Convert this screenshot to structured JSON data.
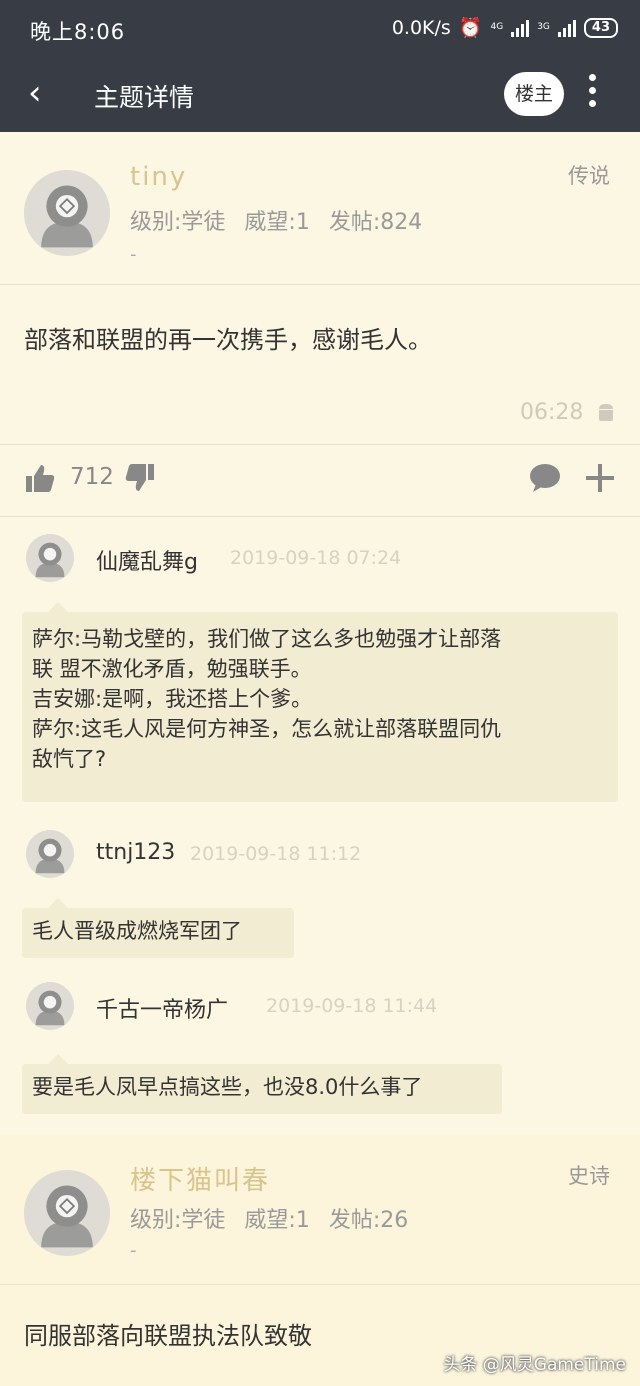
{
  "status_bar": {
    "time": "晚上8:06",
    "speed": "0.0K/s",
    "net1": "4G",
    "net2": "3G",
    "battery": "43"
  },
  "header": {
    "back_icon": "chevron-left-icon",
    "title": "主题详情",
    "op_button": "楼主",
    "more_icon": "more-vertical-icon"
  },
  "post1": {
    "username": "tiny",
    "rank": "传说",
    "level": "级别:学徒",
    "prestige": "威望:1",
    "posts": "发帖:824",
    "signature": "-",
    "content": "部落和联盟的再一次携手，感谢毛人。",
    "time": "06:28",
    "like_count": "712",
    "comments": [
      {
        "name": "仙魔乱舞g",
        "time": "2019-09-18 07:24",
        "lines": [
          "萨尔:马勒戈壁的，我们做了这么多也勉强才让部落",
          "联 盟不激化矛盾，勉强联手。",
          "吉安娜:是啊，我还搭上个爹。",
          "萨尔:这毛人风是何方神圣，怎么就让部落联盟同仇",
          "敌忾了?"
        ]
      },
      {
        "name": "ttnj123",
        "time": "2019-09-18 11:12",
        "lines": [
          "毛人晋级成燃烧军团了"
        ]
      },
      {
        "name": "千古一帝杨广",
        "time": "2019-09-18 11:44",
        "lines": [
          "要是毛人凤早点搞这些，也没8.0什么事了"
        ]
      }
    ]
  },
  "post2": {
    "username": "楼下猫叫春",
    "rank": "史诗",
    "level": "级别:学徒",
    "prestige": "威望:1",
    "posts": "发帖:26",
    "signature": "-",
    "content": "同服部落向联盟执法队致敬"
  },
  "watermark": "头条 @风灵GameTime"
}
